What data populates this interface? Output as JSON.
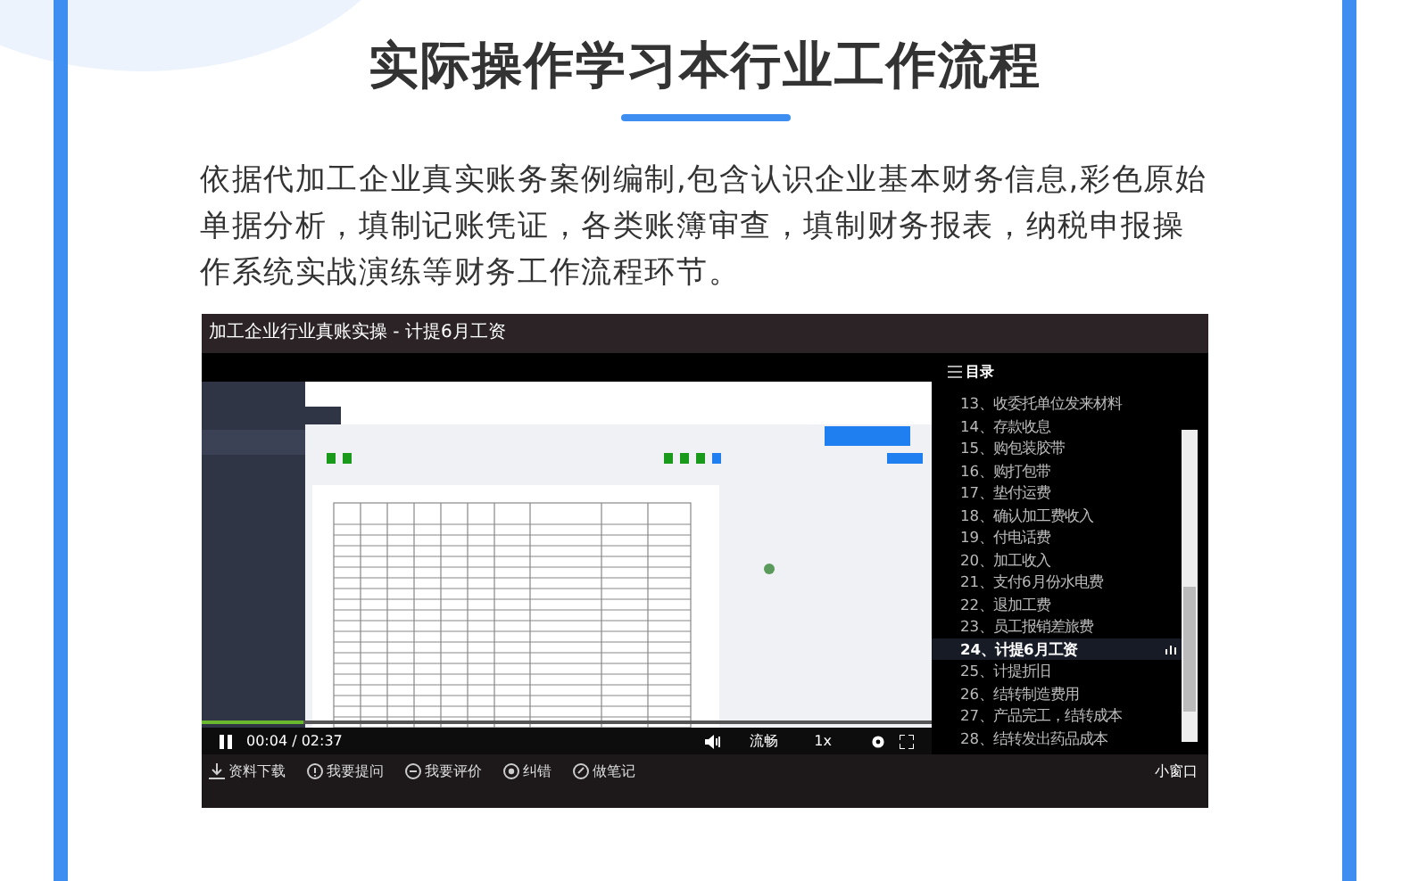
{
  "heading": {
    "title": "实际操作学习本行业工作流程",
    "description": "依据代加工企业真实账务案例编制,包含认识企业基本财务信息,彩色原始单据分析，填制记账凭证，各类账簿审查，填制财务报表，纳税申报操作系统实战演练等财务工作流程环节。"
  },
  "player": {
    "title": "加工企业行业真账实操 - 计提6月工资",
    "progress": {
      "level": 0.14
    },
    "controls": {
      "playing": true,
      "time": "00:04 / 02:37",
      "quality": "流畅",
      "speed": "1x"
    },
    "toc": {
      "title": "目录",
      "items": [
        {
          "label": "13、收委托单位发来材料",
          "selected": false
        },
        {
          "label": "14、存款收息",
          "selected": false
        },
        {
          "label": "15、购包装胶带",
          "selected": false
        },
        {
          "label": "16、购打包带",
          "selected": false
        },
        {
          "label": "17、垫付运费",
          "selected": false
        },
        {
          "label": "18、确认加工费收入",
          "selected": false
        },
        {
          "label": "19、付电话费",
          "selected": false
        },
        {
          "label": "20、加工收入",
          "selected": false
        },
        {
          "label": "21、支付6月份水电费",
          "selected": false
        },
        {
          "label": "22、退加工费",
          "selected": false
        },
        {
          "label": "23、员工报销差旅费",
          "selected": false
        },
        {
          "label": "24、计提6月工资",
          "selected": true
        },
        {
          "label": "25、计提折旧",
          "selected": false
        },
        {
          "label": "26、结转制造费用",
          "selected": false
        },
        {
          "label": "27、产品完工，结转成本",
          "selected": false
        },
        {
          "label": "28、结转发出药品成本",
          "selected": false
        }
      ]
    },
    "actions": [
      {
        "kind": "download",
        "label": "资料下载"
      },
      {
        "kind": "question",
        "label": "我要提问"
      },
      {
        "kind": "rate",
        "label": "我要评价"
      },
      {
        "kind": "error",
        "label": "纠错"
      },
      {
        "kind": "note",
        "label": "做笔记"
      }
    ],
    "mini_window": "小窗口"
  }
}
